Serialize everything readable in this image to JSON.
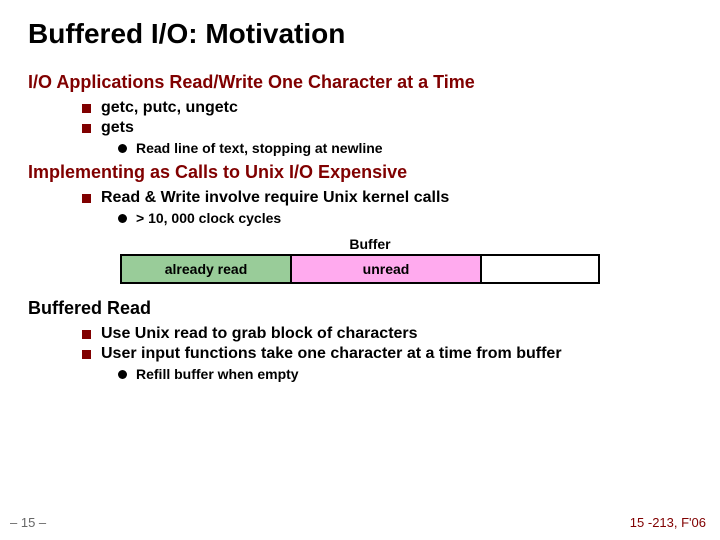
{
  "title": "Buffered I/O: Motivation",
  "sections": {
    "s1": {
      "heading": "I/O Applications Read/Write One Character at a Time",
      "items": [
        "getc, putc, ungetc",
        "gets"
      ],
      "sub": [
        "Read line of text, stopping at newline"
      ]
    },
    "s2": {
      "heading": "Implementing as Calls to Unix I/O Expensive",
      "items": [
        "Read & Write involve require Unix kernel calls"
      ],
      "sub": [
        "> 10, 000 clock cycles"
      ]
    },
    "buffer": {
      "label": "Buffer",
      "cells": {
        "read": "already read",
        "unread": "unread"
      }
    },
    "s3": {
      "heading": "Buffered Read",
      "items": [
        "Use Unix read to grab block of characters",
        "User input functions take one character at a time from buffer"
      ],
      "sub": [
        "Refill buffer when empty"
      ]
    }
  },
  "footer": {
    "left": "– 15 –",
    "right": "15 -213, F'06"
  }
}
